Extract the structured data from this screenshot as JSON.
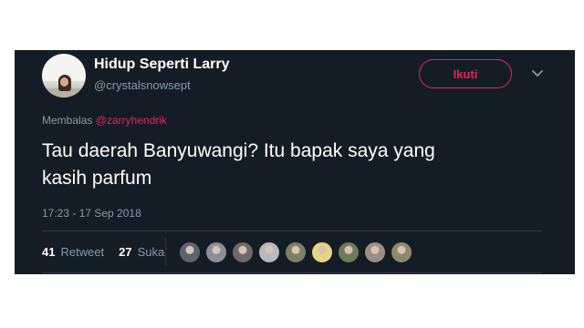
{
  "user": {
    "display_name": "Hidup Seperti Larry",
    "handle": "@crystalsnowsept"
  },
  "follow_label": "Ikuti",
  "reply": {
    "prefix": "Membalas",
    "mention": "@zarryhendrik"
  },
  "tweet": {
    "text_line1": "Tau daerah Banyuwangi? Itu bapak saya yang",
    "text_line2": "kasih parfum",
    "timestamp": "17:23 - 17 Sep 2018"
  },
  "stats": {
    "retweets": "41",
    "retweet_label": "Retweet",
    "likes": "27",
    "like_label": "Suka"
  },
  "colors": {
    "background": "#141d26",
    "accent": "#e0245e",
    "muted": "#8899a6"
  },
  "liker_avatar_colors": [
    "#5b6470",
    "#8a8f96",
    "#6d6a6c",
    "#b4b9c2",
    "#7a7f66",
    "#e6d487",
    "#6e7a5e",
    "#9a8f86",
    "#8d8a6a"
  ]
}
